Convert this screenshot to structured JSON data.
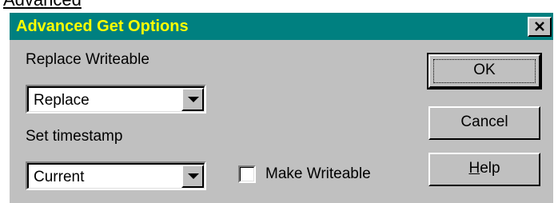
{
  "caption": "Advanced",
  "dialog": {
    "title": "Advanced Get Options",
    "close_icon": "close-icon"
  },
  "fields": {
    "replace_writeable": {
      "label": "Replace Writeable",
      "value": "Replace",
      "arrow_icon": "chevron-down-icon"
    },
    "set_timestamp": {
      "label": "Set timestamp",
      "value": "Current",
      "arrow_icon": "chevron-down-icon"
    },
    "make_writeable": {
      "label": "Make Writeable",
      "checked": false
    }
  },
  "buttons": {
    "ok": "OK",
    "cancel": "Cancel",
    "help_mnemonic": "H",
    "help_rest": "elp"
  }
}
